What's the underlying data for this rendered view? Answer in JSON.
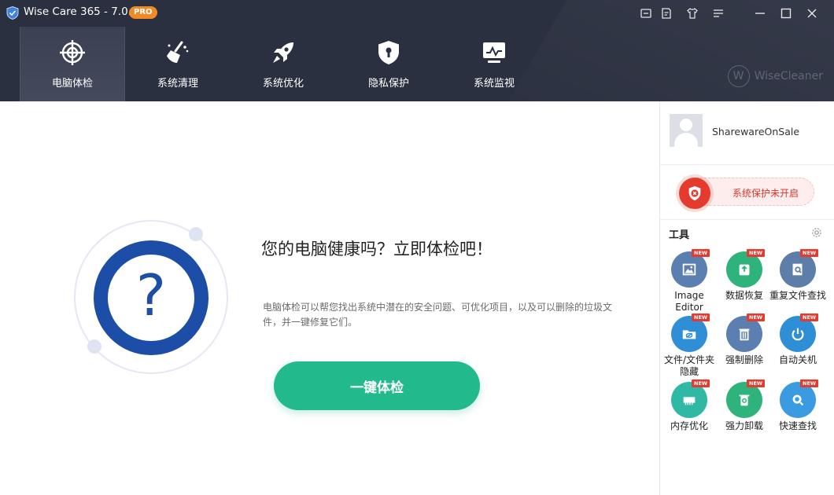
{
  "window": {
    "title": "Wise Care 365 - 7.0.2",
    "badge": "PRO"
  },
  "nav": {
    "items": [
      {
        "label": "电脑体检",
        "icon": "crosshair-icon"
      },
      {
        "label": "系统清理",
        "icon": "broom-icon"
      },
      {
        "label": "系统优化",
        "icon": "rocket-icon"
      },
      {
        "label": "隐私保护",
        "icon": "shield-lock-icon"
      },
      {
        "label": "系统监视",
        "icon": "monitor-icon"
      }
    ]
  },
  "brand": {
    "logo": "W",
    "name": "WiseCleaner"
  },
  "main": {
    "title": "您的电脑健康吗？立即体检吧！",
    "description": "电脑体检可以帮您找出系统中潜在的安全问题、可优化项目，以及可以删除的垃圾文件，并一键修复它们。",
    "button": "一键体检",
    "question_mark": "?"
  },
  "sidebar": {
    "user_name": "SharewareOnSale",
    "protect_text": "系统保护未开启",
    "tools_label": "工具",
    "new_badge": "NEW",
    "tools": [
      {
        "label": "Image Editor",
        "color": "#5a7fb0",
        "icon": "image-editor-icon"
      },
      {
        "label": "数据恢复",
        "color": "#2fb37c",
        "icon": "data-recovery-icon"
      },
      {
        "label": "重复文件查找",
        "color": "#5d7ea8",
        "icon": "duplicate-files-icon"
      },
      {
        "label": "文件/文件夹隐藏",
        "color": "#2f8fd6",
        "icon": "folder-hide-icon"
      },
      {
        "label": "强制删除",
        "color": "#5a7fb0",
        "icon": "force-delete-icon"
      },
      {
        "label": "自动关机",
        "color": "#2f8fd6",
        "icon": "power-icon"
      },
      {
        "label": "内存优化",
        "color": "#2fb8a4",
        "icon": "memory-icon"
      },
      {
        "label": "强力卸载",
        "color": "#2fb37c",
        "icon": "uninstall-icon"
      },
      {
        "label": "快速查找",
        "color": "#3a9be0",
        "icon": "search-icon"
      }
    ]
  }
}
